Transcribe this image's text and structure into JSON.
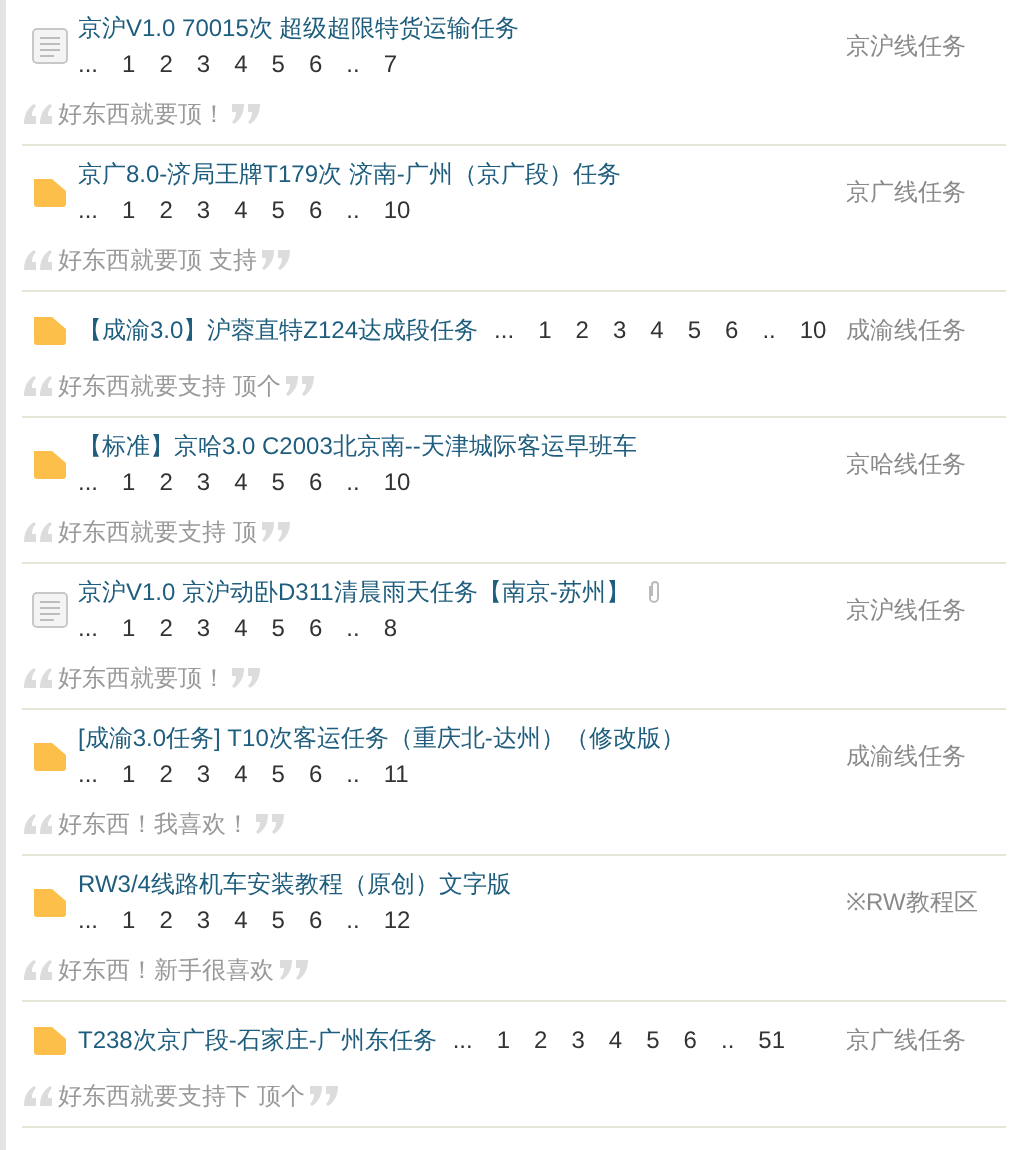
{
  "threads": [
    {
      "kind": "document",
      "title": "京沪V1.0 70015次 超级超限特货运输任务",
      "attachment": false,
      "pages_inline": false,
      "pages": [
        "...",
        "1",
        "2",
        "3",
        "4",
        "5",
        "6",
        "..",
        "7"
      ],
      "category": "京沪线任务",
      "comment": "好东西就要顶！"
    },
    {
      "kind": "folder",
      "title": "京广8.0-济局王牌T179次 济南-广州（京广段）任务",
      "attachment": false,
      "pages_inline": false,
      "pages": [
        "...",
        "1",
        "2",
        "3",
        "4",
        "5",
        "6",
        "..",
        "10"
      ],
      "category": "京广线任务",
      "comment": "好东西就要顶 支持"
    },
    {
      "kind": "folder",
      "title": "【成渝3.0】沪蓉直特Z124达成段任务",
      "attachment": false,
      "pages_inline": true,
      "pages": [
        "...",
        "1",
        "2",
        "3",
        "4",
        "5",
        "6",
        "..",
        "10"
      ],
      "category": "成渝线任务",
      "comment": "好东西就要支持 顶个"
    },
    {
      "kind": "folder",
      "title": "【标准】京哈3.0 C2003北京南--天津城际客运早班车",
      "attachment": false,
      "pages_inline": false,
      "pages": [
        "...",
        "1",
        "2",
        "3",
        "4",
        "5",
        "6",
        "..",
        "10"
      ],
      "category": "京哈线任务",
      "comment": "好东西就要支持 顶"
    },
    {
      "kind": "document",
      "title": "京沪V1.0 京沪动卧D311清晨雨天任务【南京-苏州】",
      "attachment": true,
      "pages_inline": false,
      "pages": [
        "...",
        "1",
        "2",
        "3",
        "4",
        "5",
        "6",
        "..",
        "8"
      ],
      "category": "京沪线任务",
      "comment": "好东西就要顶！"
    },
    {
      "kind": "folder",
      "title": "[成渝3.0任务] T10次客运任务（重庆北-达州）（修改版）",
      "attachment": false,
      "pages_inline": false,
      "pages": [
        "...",
        "1",
        "2",
        "3",
        "4",
        "5",
        "6",
        "..",
        "11"
      ],
      "category": "成渝线任务",
      "comment": "好东西！我喜欢！"
    },
    {
      "kind": "folder",
      "title": "RW3/4线路机车安装教程（原创）文字版",
      "attachment": false,
      "pages_inline": false,
      "pages": [
        "...",
        "1",
        "2",
        "3",
        "4",
        "5",
        "6",
        "..",
        "12"
      ],
      "category": "※RW教程区",
      "comment": "好东西！新手很喜欢"
    },
    {
      "kind": "folder",
      "title": "T238次京广段-石家庄-广州东任务",
      "attachment": false,
      "pages_inline": true,
      "pages": [
        "...",
        "1",
        "2",
        "3",
        "4",
        "5",
        "6",
        "..",
        "51"
      ],
      "category": "京广线任务",
      "comment": "好东西就要支持下 顶个"
    }
  ]
}
